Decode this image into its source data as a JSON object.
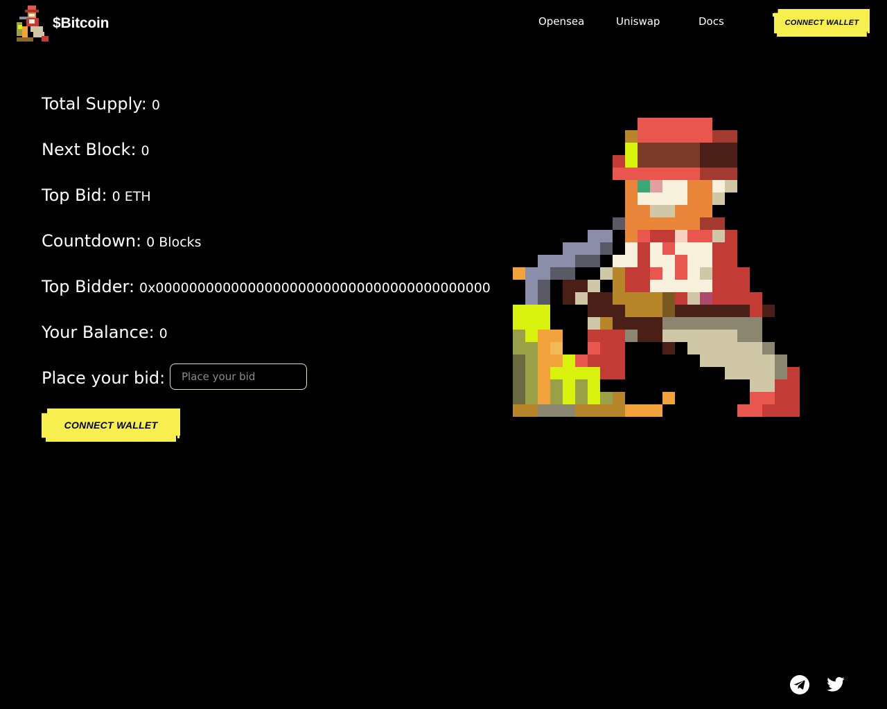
{
  "header": {
    "brand": "$Bitcoin",
    "nav": [
      "Opensea",
      "Uniswap",
      "Docs"
    ],
    "connect_wallet": "Connect Wallet"
  },
  "stats": {
    "total_supply": {
      "label": "Total Supply:",
      "value": "0"
    },
    "next_block": {
      "label": "Next Block:",
      "value": "0"
    },
    "top_bid": {
      "label": "Top Bid:",
      "value": "0 ETH"
    },
    "countdown": {
      "label": "Countdown:",
      "value": "0 Blocks"
    },
    "top_bidder": {
      "label": "Top Bidder:",
      "value": "0x0000000000000000000000000000000000000000"
    },
    "your_balance": {
      "label": "Your Balance:",
      "value": "0"
    }
  },
  "bid": {
    "label": "Place your bid:",
    "placeholder": "Place your bid",
    "value": "",
    "connect_wallet": "Connect Wallet"
  },
  "footer": {
    "icons": [
      "telegram-icon",
      "twitter-icon"
    ]
  },
  "colors": {
    "background": "#000000",
    "accent": "#f6ef4e",
    "text": "#ffffff"
  }
}
